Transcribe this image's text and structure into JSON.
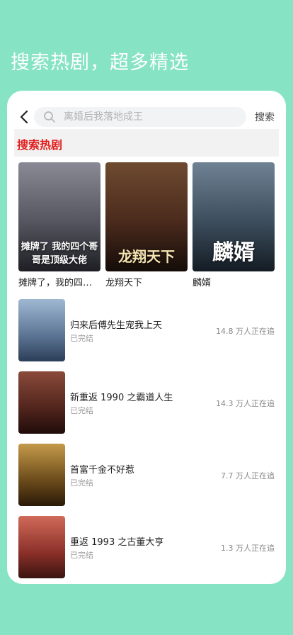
{
  "headline": "搜索热剧，超多精选",
  "search": {
    "placeholder": "离婚后我落地成王",
    "button_label": "搜索"
  },
  "section_title": "搜索热剧",
  "featured": [
    {
      "title": "摊牌了，我的四个哥哥是顶级大佬",
      "poster_text": "摊牌了 我的四个哥哥是顶级大佬",
      "colors": [
        "#6b6b78",
        "#2b2b33"
      ]
    },
    {
      "title": "龙翔天下",
      "poster_text": "龙翔天下",
      "colors": [
        "#5b3a2a",
        "#1a1010"
      ]
    },
    {
      "title": "麟婿",
      "poster_text": "麟婿",
      "colors": [
        "#4a5b6b",
        "#1b2530"
      ]
    }
  ],
  "list": [
    {
      "name": "归来后傅先生宠我上天",
      "status": "已完结",
      "count": "14.8 万人正在追",
      "colors": [
        "#7f9fbf",
        "#2c3e58"
      ]
    },
    {
      "name": "新重返 1990 之霸道人生",
      "status": "已完结",
      "count": "14.3 万人正在追",
      "colors": [
        "#6b3a30",
        "#200c0a"
      ]
    },
    {
      "name": "首富千金不好惹",
      "status": "已完结",
      "count": "7.7 万人正在追",
      "colors": [
        "#a07a3a",
        "#2a1a08"
      ]
    },
    {
      "name": "重返 1993 之古董大亨",
      "status": "已完结",
      "count": "1.3 万人正在追",
      "colors": [
        "#b5433c",
        "#3a1410"
      ]
    }
  ],
  "colors": {
    "background": "#86e3c3",
    "accent_red": "#e0201e"
  }
}
